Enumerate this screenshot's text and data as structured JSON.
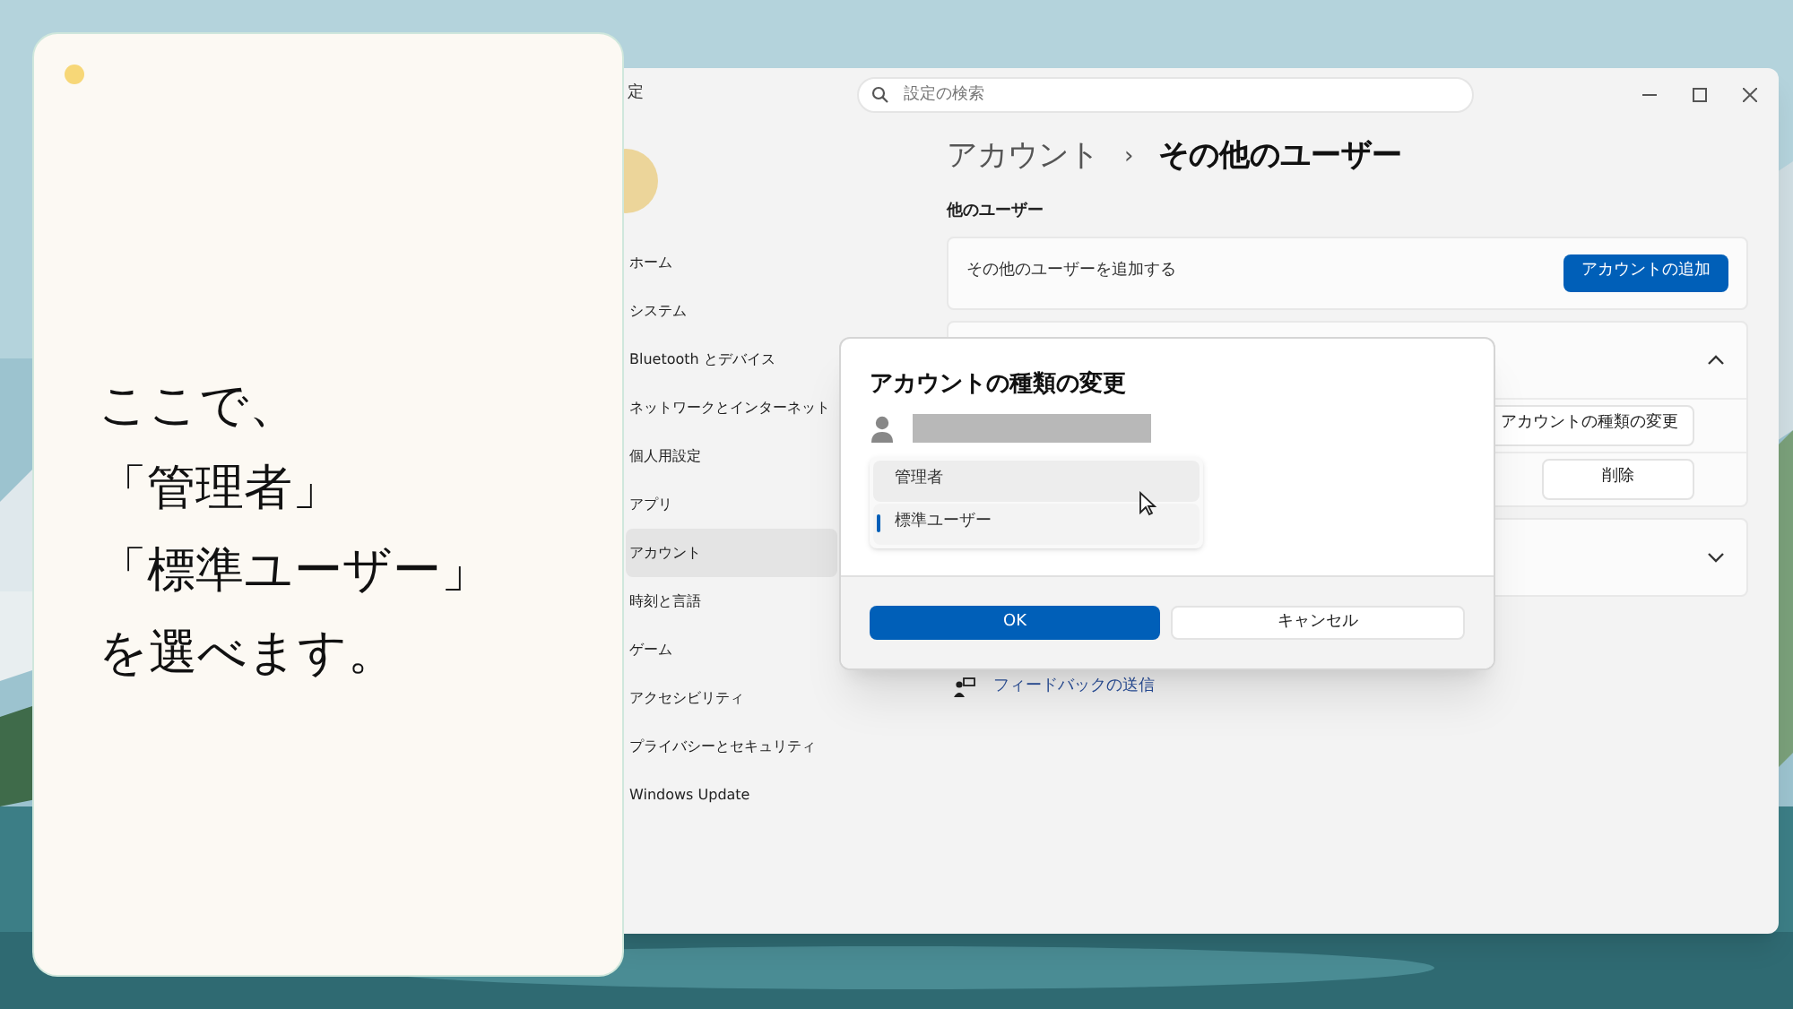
{
  "note_card": {
    "lines": [
      "ここで、",
      "「管理者」",
      "「標準ユーザー」",
      "を選べます。"
    ]
  },
  "settings_window": {
    "title": "定",
    "search": {
      "placeholder": "設定の検索"
    },
    "sidebar": {
      "items": [
        {
          "label": "ホーム",
          "selected": false
        },
        {
          "label": "システム",
          "selected": false
        },
        {
          "label": "Bluetooth とデバイス",
          "selected": false
        },
        {
          "label": "ネットワークとインターネット",
          "selected": false
        },
        {
          "label": "個人用設定",
          "selected": false
        },
        {
          "label": "アプリ",
          "selected": false
        },
        {
          "label": "アカウント",
          "selected": true
        },
        {
          "label": "時刻と言語",
          "selected": false
        },
        {
          "label": "ゲーム",
          "selected": false
        },
        {
          "label": "アクセシビリティ",
          "selected": false
        },
        {
          "label": "プライバシーとセキュリティ",
          "selected": false
        },
        {
          "label": "Windows Update",
          "selected": false
        }
      ]
    },
    "breadcrumb": {
      "parent": "アカウント",
      "separator": "›",
      "current": "その他のユーザー"
    },
    "section_title": "他のユーザー",
    "add_user": {
      "label": "その他のユーザーを追加する",
      "button": "アカウントの追加"
    },
    "user_cards": [
      {
        "expanded": true,
        "actions": [
          "アカウントの種類の変更",
          "削除"
        ]
      },
      {
        "expanded": false
      }
    ],
    "feedback_link": "フィードバックの送信"
  },
  "dialog": {
    "title": "アカウントの種類の変更",
    "options": [
      {
        "label": "管理者",
        "selected": false,
        "hovered": true
      },
      {
        "label": "標準ユーザー",
        "selected": true,
        "hovered": false
      }
    ],
    "buttons": [
      {
        "label": "OK",
        "kind": "primary"
      },
      {
        "label": "キャンセル",
        "kind": "secondary"
      }
    ]
  }
}
